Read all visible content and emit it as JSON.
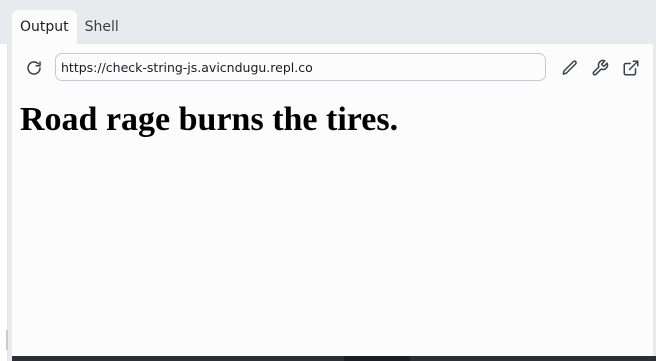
{
  "tabs": [
    {
      "label": "Output",
      "active": true
    },
    {
      "label": "Shell",
      "active": false
    }
  ],
  "toolbar": {
    "url": "https://check-string-js.avicndugu.repl.co",
    "icons": [
      "reload-icon",
      "pencil-icon",
      "wrench-icon",
      "external-link-icon"
    ]
  },
  "page": {
    "headline": "Road rage burns the tires."
  },
  "colors": {
    "background": "#e9eaee",
    "panel": "#fcfcfd",
    "bottom_bar": "#2b2e37"
  }
}
